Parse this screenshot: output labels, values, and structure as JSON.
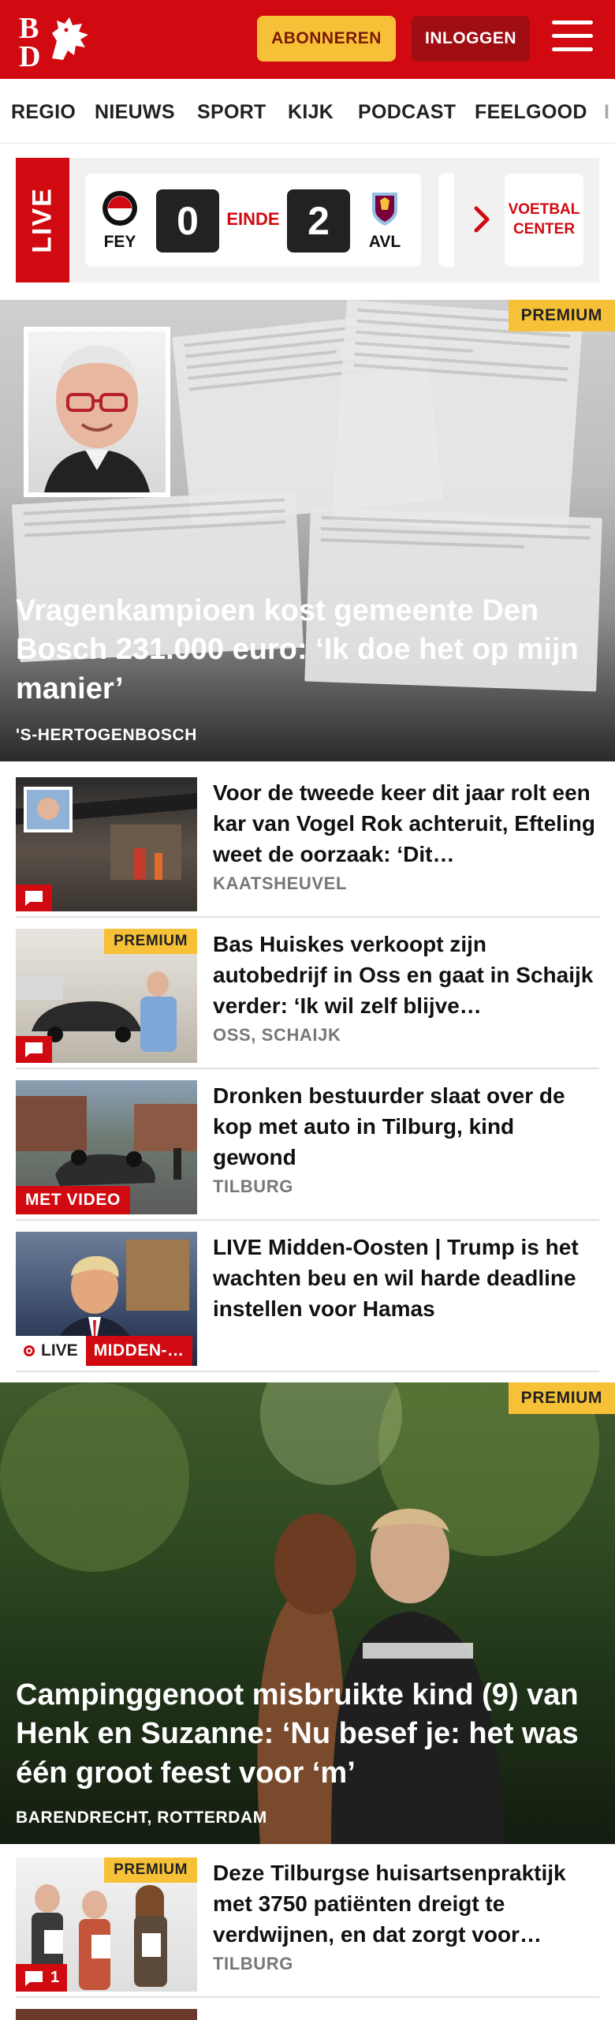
{
  "header": {
    "subscribe_label": "ABONNEREN",
    "login_label": "INLOGGEN"
  },
  "nav": {
    "items": [
      "REGIO",
      "NIEUWS",
      "SPORT",
      "KIJK",
      "PODCAST",
      "FEELGOOD",
      "I"
    ]
  },
  "live": {
    "label": "LIVE",
    "home_team": "FEY",
    "away_team": "AVL",
    "home_score": "0",
    "away_score": "2",
    "status": "EINDE",
    "center_label_1": "VOETBAL",
    "center_label_2": "CENTER"
  },
  "hero1": {
    "badge": "PREMIUM",
    "title": "Vragenkampioen kost gemeente Den Bosch 231.000 euro: ‘Ik doe het op mijn manier’",
    "location": "'S-HERTOGENBOSCH"
  },
  "articles": [
    {
      "title": "Voor de tweede keer dit jaar rolt een kar van Vogel Rok achteruit, Efteling weet de oorzaak: ‘Dit…",
      "location": "KAATSHEUVEL"
    },
    {
      "badge": "PREMIUM",
      "title": "Bas Huiskes verkoopt zijn autobedrijf in Oss en gaat in Schaijk verder: ‘Ik wil zelf blijve…",
      "location": "OSS, SCHAIJK"
    },
    {
      "video_label": "MET VIDEO",
      "title": "Dronken bestuurder slaat over de kop met auto in Tilburg, kind gewond",
      "location": "TILBURG"
    },
    {
      "live_label": "LIVE",
      "topic_label": "MIDDEN-…",
      "title": "LIVE Midden-Oosten | Trump is het wachten beu en wil harde deadline instellen voor Hamas"
    }
  ],
  "hero2": {
    "badge": "PREMIUM",
    "title": "Campinggenoot misbruikte kind (9) van Henk en Suzanne: ‘Nu besef je: het was één groot feest voor ‘m’",
    "location": "BARENDRECHT, ROTTERDAM"
  },
  "article5": {
    "badge": "PREMIUM",
    "comment_count": "1",
    "title": "Deze Tilburgse huisartsenprak­tijk met 3750 patiënten dreigt te verdwijnen, en dat zorgt voor…",
    "location": "TILBURG"
  },
  "colors": {
    "brand_red": "#d10a11",
    "premium_yellow": "#f6c137"
  }
}
